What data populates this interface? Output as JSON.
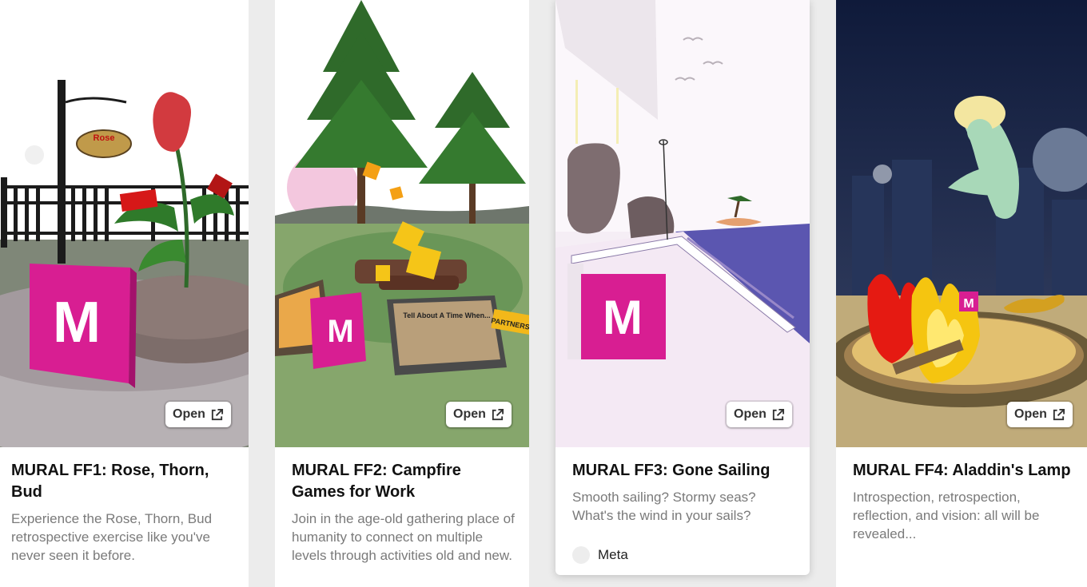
{
  "cards": [
    {
      "title": "MURAL FF1: Rose, Thorn, Bud",
      "description": "Experience the Rose, Thorn, Bud retrospective exercise like you've never seen it before.",
      "open_label": "Open",
      "thumb_icon": "mural-logo-icon",
      "sign_text": "Rose"
    },
    {
      "title": "MURAL FF2: Campfire Games for Work",
      "description": "Join in the age-old gathering place of humanity to connect on multiple levels through activities old and new.",
      "open_label": "Open",
      "thumb_icon": "mural-logo-icon",
      "plaque_text": "Tell About A Time When...",
      "banner_text": "PARTNERSH"
    },
    {
      "title": "MURAL FF3: Gone Sailing",
      "description": "Smooth sailing? Stormy seas? What's the wind in your sails?",
      "open_label": "Open",
      "author": "Meta",
      "thumb_icon": "mural-logo-icon"
    },
    {
      "title": "MURAL FF4: Aladdin's Lamp",
      "description": "Introspection, retrospection, reflection, and vision: all will be revealed...",
      "open_label": "Open",
      "thumb_icon": "mural-logo-icon"
    }
  ],
  "colors": {
    "brand_magenta": "#e0179a",
    "title_text": "#111111",
    "description_text": "#7a7a7a",
    "page_background": "#ececec"
  }
}
